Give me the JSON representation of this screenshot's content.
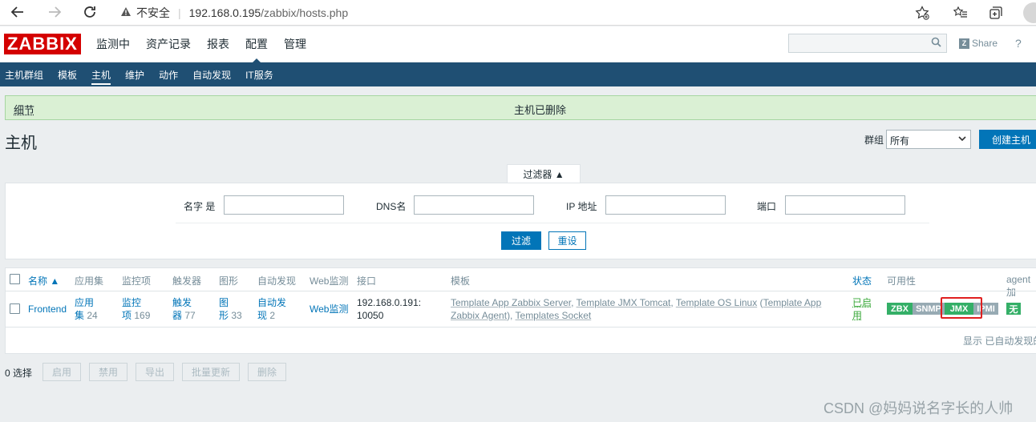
{
  "browser": {
    "insecure_label": "不安全",
    "url_host": "192.168.0.195",
    "url_path": "/zabbix/hosts.php"
  },
  "header": {
    "logo": "ZABBIX",
    "menu": [
      "监测中",
      "资产记录",
      "报表",
      "配置",
      "管理"
    ],
    "active_menu": "配置",
    "share_label": "Share",
    "help_label": "?"
  },
  "subnav": {
    "items": [
      "主机群组",
      "模板",
      "主机",
      "维护",
      "动作",
      "自动发现",
      "IT服务"
    ],
    "active": "主机"
  },
  "message": {
    "details": "细节",
    "text": "主机已删除"
  },
  "page": {
    "title": "主机",
    "group_label": "群组",
    "group_value": "所有",
    "create_button": "创建主机"
  },
  "filter": {
    "tab_label": "过滤器 ▲",
    "name_label": "名字 是",
    "dns_label": "DNS名",
    "ip_label": "IP 地址",
    "port_label": "端口",
    "apply_button": "过滤",
    "reset_button": "重设"
  },
  "table": {
    "headers": {
      "name": "名称 ▲",
      "apps": "应用集",
      "items": "监控项",
      "triggers": "触发器",
      "graphs": "图形",
      "discovery": "自动发现",
      "web": "Web监测",
      "interface": "接口",
      "templates": "模板",
      "status": "状态",
      "availability": "可用性",
      "agent": "agent 加"
    },
    "row": {
      "name": "Frontend",
      "apps_a": "应用",
      "apps_b": "集",
      "apps_count": "24",
      "items_a": "监控",
      "items_b": "项",
      "items_count": "169",
      "triggers_a": "触发",
      "triggers_b": "器",
      "triggers_count": "77",
      "graphs_a": "图",
      "graphs_b": "形",
      "graphs_count": "33",
      "discovery_a": "自动发",
      "discovery_b": "现",
      "discovery_count": "2",
      "web": "Web监测",
      "interface_line1": "192.168.0.191:",
      "interface_line2": "10050",
      "tmpl1": "Template App Zabbix Server",
      "tmpl2": "Template JMX Tomcat",
      "tmpl3": "Template OS Linux",
      "tmpl4": "Template App",
      "tmpl5": "Zabbix Agent",
      "tmpl6": "Templates Socket",
      "status_a": "已启",
      "status_b": "用",
      "badges": {
        "zbx": "ZBX",
        "snmp": "SNMP",
        "jmx": "JMX",
        "ipmi": "IPMI",
        "none": "无"
      }
    },
    "footer": "显示 已自动发现的"
  },
  "actions": {
    "selected": "0 选择",
    "enable": "启用",
    "disable": "禁用",
    "export": "导出",
    "mass_update": "批量更新",
    "delete": "删除"
  },
  "watermark": "CSDN @妈妈说名字长的人帅"
}
